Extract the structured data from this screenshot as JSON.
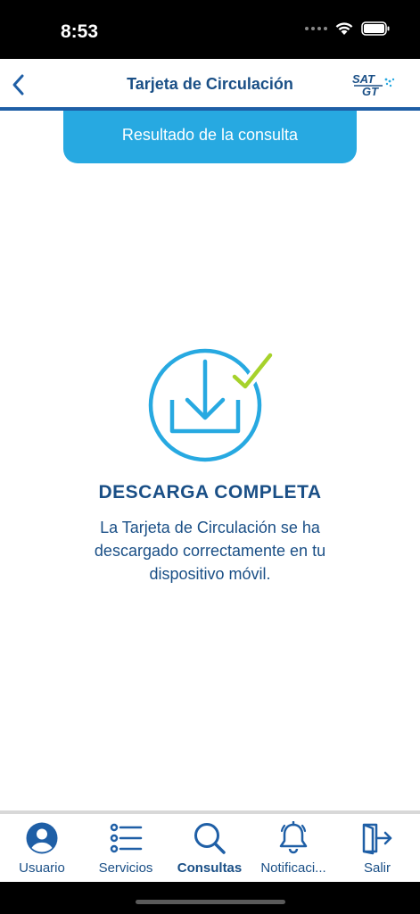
{
  "status_bar": {
    "time": "8:53"
  },
  "nav": {
    "title": "Tarjeta de Circulación",
    "logo_text_top": "SAT",
    "logo_text_bottom": "GT"
  },
  "result_header": {
    "label": "Resultado de la consulta"
  },
  "content": {
    "headline": "DESCARGA COMPLETA",
    "message": "La Tarjeta de Circulación se ha descargado correctamente en tu dispositivo móvil."
  },
  "tabs": [
    {
      "label": "Usuario",
      "icon": "user-icon",
      "active": false
    },
    {
      "label": "Servicios",
      "icon": "list-icon",
      "active": false
    },
    {
      "label": "Consultas",
      "icon": "search-icon",
      "active": true
    },
    {
      "label": "Notificaci...",
      "icon": "bell-icon",
      "active": false
    },
    {
      "label": "Salir",
      "icon": "exit-icon",
      "active": false
    }
  ],
  "colors": {
    "brand_dark": "#1a4f86",
    "brand_light": "#27a9e1",
    "check_green": "#a6d22b"
  }
}
